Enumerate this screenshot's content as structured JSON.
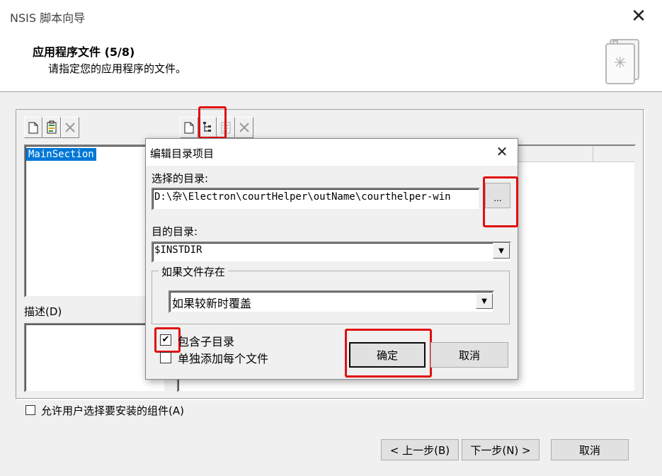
{
  "window": {
    "title": "NSIS 脚本向导",
    "close_glyph": "✕"
  },
  "header": {
    "title": "应用程序文件 (5/8)",
    "subtitle": "请指定您的应用程序的文件。"
  },
  "sections": {
    "items": [
      "MainSection"
    ],
    "description_label": "描述(D)"
  },
  "allow_select_label": "允许用户选择要安装的组件(A)",
  "nav": {
    "back": "< 上一步(B)",
    "next": "下一步(N) >",
    "cancel": "取消"
  },
  "dialog": {
    "title": "编辑目录项目",
    "close_glyph": "✕",
    "source_label": "选择的目录:",
    "source_value": "D:\\杂\\Electron\\courtHelper\\outName\\courthelper-win",
    "browse_label": "...",
    "dest_label": "目的目录:",
    "dest_value": "$INSTDIR",
    "exists_group": "如果文件存在",
    "exists_option": "如果较新时覆盖",
    "include_subdirs": "包含子目录",
    "include_subdirs_checked": true,
    "add_each_file": "单独添加每个文件",
    "add_each_file_checked": false,
    "ok": "确定",
    "cancel": "取消"
  },
  "colors": {
    "highlight": "#e01010",
    "selection": "#0078d7"
  }
}
